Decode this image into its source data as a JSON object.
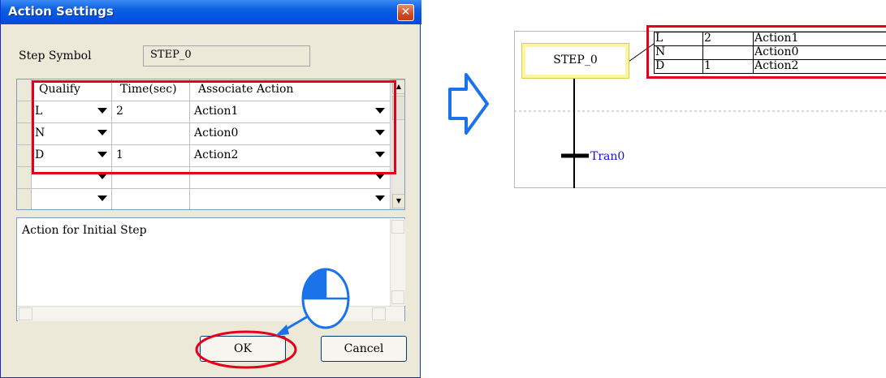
{
  "dialog": {
    "title": "Action Settings",
    "close_glyph": "✕",
    "step_symbol_label": "Step Symbol",
    "step_symbol_value": "STEP_0",
    "grid": {
      "columns": [
        "Qualify",
        "Time(sec)",
        "Associate Action"
      ],
      "rows": [
        {
          "qualify": "L",
          "time": "2",
          "action": "Action1"
        },
        {
          "qualify": "N",
          "time": "",
          "action": "Action0"
        },
        {
          "qualify": "D",
          "time": "1",
          "action": "Action2"
        },
        {
          "qualify": "",
          "time": "",
          "action": ""
        },
        {
          "qualify": "",
          "time": "",
          "action": ""
        }
      ]
    },
    "note_text": "Action for Initial Step",
    "ok_label": "OK",
    "cancel_label": "Cancel"
  },
  "diagram": {
    "step_name": "STEP_0",
    "actions": [
      {
        "qualify": "L",
        "time": "2",
        "action": "Action1"
      },
      {
        "qualify": "N",
        "time": "",
        "action": "Action0"
      },
      {
        "qualify": "D",
        "time": "1",
        "action": "Action2"
      }
    ],
    "transition_label": "Tran0"
  },
  "colors": {
    "highlight": "#e5001a",
    "arrow": "#1a73e8",
    "title_bar": "#0054e3",
    "step_border": "#fdf6a0",
    "transition_text": "#1010e0"
  },
  "icons": {
    "close": "close-icon",
    "arrow": "right-arrow-icon",
    "click_hint": "mouse-click-icon",
    "dropdown": "chevron-down-icon"
  }
}
